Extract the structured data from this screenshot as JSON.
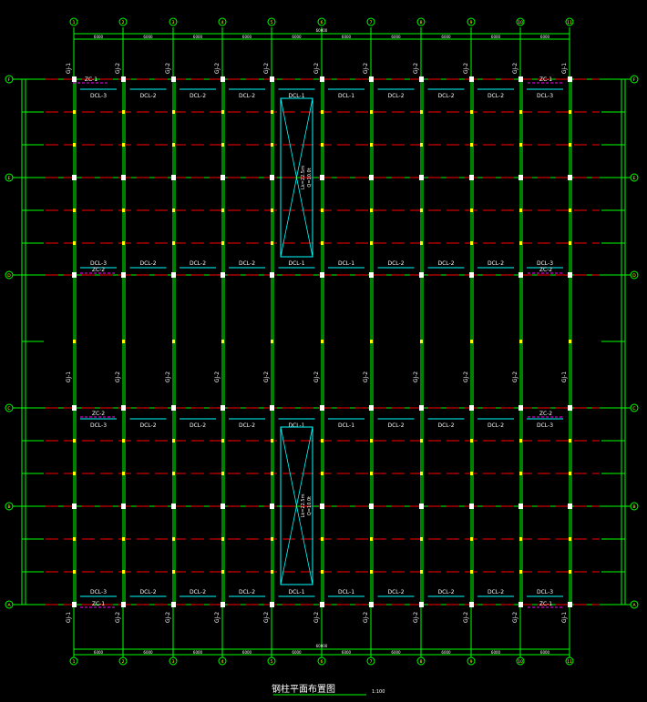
{
  "drawing": {
    "title": "钢柱平面布置图",
    "scale": "1:100",
    "colors": {
      "background": "#000000",
      "grid": "#00ff00",
      "column": "#ffffff",
      "beam_label": "#ffffff",
      "beam_line": "#00ffff",
      "purlin": "#ff0000",
      "bracing": "#ff00ff",
      "crane": "#00ffff",
      "marker": "#ffff00"
    }
  },
  "axes": {
    "columns": [
      "1",
      "2",
      "3",
      "4",
      "5",
      "6",
      "7",
      "8",
      "9",
      "10",
      "11"
    ],
    "rows": [
      "F",
      "E",
      "D",
      "C",
      "B",
      "A"
    ],
    "top_dims": [
      "6000",
      "6000",
      "6000",
      "6000",
      "6000",
      "6000",
      "6000",
      "6000",
      "6000",
      "6000"
    ],
    "top_total": "60000",
    "bottom_dims": [
      "6000",
      "6000",
      "6000",
      "6000",
      "6000",
      "6000",
      "6000",
      "6000",
      "6000",
      "6000"
    ],
    "bottom_total": "60000"
  },
  "column_labels": {
    "top": [
      "GJ-1",
      "GJ-2",
      "GJ-2",
      "GJ-2",
      "GJ-2",
      "GJ-2",
      "GJ-2",
      "GJ-2",
      "GJ-2",
      "GJ-2",
      "GJ-1"
    ],
    "middle": [
      "GJ-1",
      "GJ-2",
      "GJ-2",
      "GJ-2",
      "GJ-2",
      "GJ-2",
      "GJ-2",
      "GJ-2",
      "GJ-2",
      "GJ-2",
      "GJ-1"
    ],
    "bottom": [
      "GJ-1",
      "GJ-2",
      "GJ-2",
      "GJ-2",
      "GJ-2",
      "GJ-2",
      "GJ-2",
      "GJ-2",
      "GJ-2",
      "GJ-2",
      "GJ-1"
    ]
  },
  "beam_rows": {
    "row_f": [
      "DCL-3",
      "DCL-2",
      "DCL-2",
      "DCL-2",
      "DCL-1",
      "DCL-1",
      "DCL-2",
      "DCL-2",
      "DCL-2",
      "DCL-3"
    ],
    "row_d": [
      "DCL-3",
      "DCL-2",
      "DCL-2",
      "DCL-2",
      "DCL-1",
      "DCL-1",
      "DCL-2",
      "DCL-2",
      "DCL-2",
      "DCL-3"
    ],
    "row_c": [
      "DCL-3",
      "DCL-2",
      "DCL-2",
      "DCL-2",
      "DCL-1",
      "DCL-1",
      "DCL-2",
      "DCL-2",
      "DCL-2",
      "DCL-3"
    ],
    "row_a": [
      "DCL-3",
      "DCL-2",
      "DCL-2",
      "DCL-2",
      "DCL-1",
      "DCL-1",
      "DCL-2",
      "DCL-2",
      "DCL-2",
      "DCL-3"
    ]
  },
  "bracing_labels": {
    "top_left": "ZC-1",
    "top_right": "ZC-1",
    "d_left": "ZC-2",
    "d_right": "ZC-2",
    "c_left": "ZC-2",
    "c_right": "ZC-2",
    "bottom_left": "ZC-1",
    "bottom_right": "ZC-1"
  },
  "cranes": [
    {
      "span_label": "Lk=22.5m",
      "capacity": "Q=10.0t"
    },
    {
      "span_label": "Lk=22.5m",
      "capacity": "Q=10.0t"
    }
  ]
}
